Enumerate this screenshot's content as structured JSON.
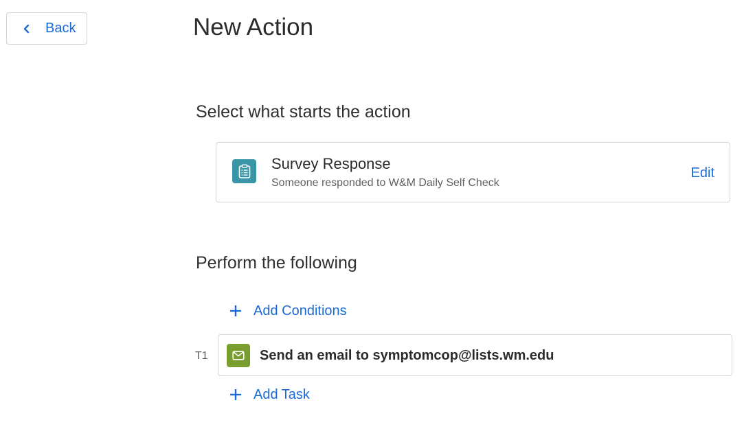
{
  "header": {
    "back_label": "Back",
    "title": "New Action"
  },
  "trigger_section": {
    "heading": "Select what starts the action",
    "card": {
      "icon": "clipboard-list-icon",
      "icon_color": "#3a95a6",
      "title": "Survey Response",
      "subtitle": "Someone responded to W&M Daily Self Check",
      "edit_label": "Edit"
    }
  },
  "perform_section": {
    "heading": "Perform the following",
    "add_conditions_label": "Add Conditions",
    "tasks": [
      {
        "id": "T1",
        "icon": "envelope-icon",
        "icon_color": "#7a9e2e",
        "label": "Send an email to symptomcop@lists.wm.edu"
      }
    ],
    "add_task_label": "Add Task"
  },
  "colors": {
    "link": "#1a6ad4",
    "border": "#d6d6d6",
    "text": "#2b2b2b",
    "muted_text": "#5f5f5f"
  }
}
